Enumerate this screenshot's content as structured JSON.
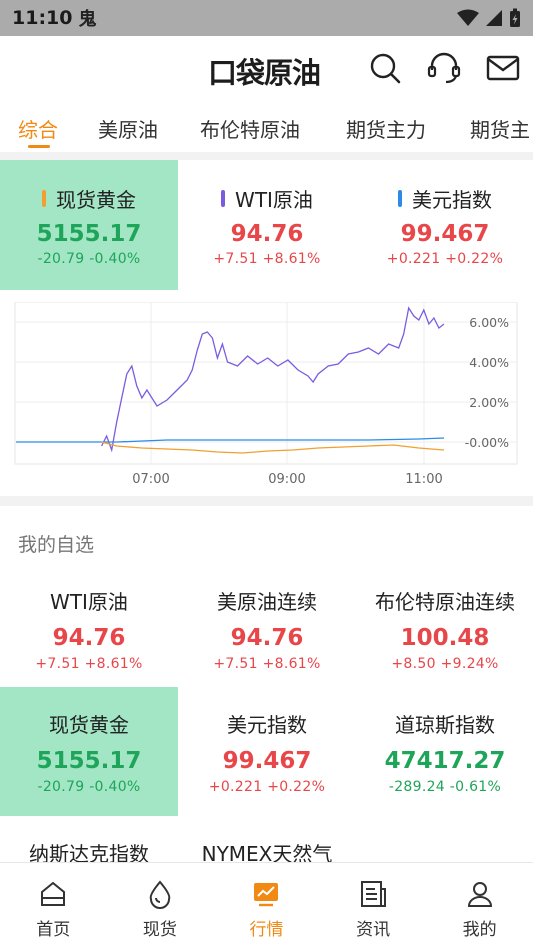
{
  "status": {
    "time": "11:10",
    "extra": "鬼"
  },
  "header": {
    "logo_text": "口袋原油"
  },
  "tabs": [
    {
      "label": "综合",
      "active": true
    },
    {
      "label": "美原油"
    },
    {
      "label": "布伦特原油"
    },
    {
      "label": "期货主力"
    },
    {
      "label": "期货主"
    }
  ],
  "top_indices": [
    {
      "name": "现货黄金",
      "price": "5155.17",
      "change": "-20.79",
      "percent": "-0.40%",
      "direction": "down",
      "marker_color": "#f0a030",
      "highlight": true
    },
    {
      "name": "WTI原油",
      "price": "94.76",
      "change": "+7.51",
      "percent": "+8.61%",
      "direction": "up",
      "marker_color": "#7b5ce0",
      "highlight": false
    },
    {
      "name": "美元指数",
      "price": "99.467",
      "change": "+0.221",
      "percent": "+0.22%",
      "direction": "up",
      "marker_color": "#2b8be6",
      "highlight": false
    }
  ],
  "chart_data": {
    "type": "line",
    "x_ticks": [
      "07:00",
      "09:00",
      "11:00"
    ],
    "y_ticks": [
      "6.00%",
      "4.00%",
      "2.00%",
      "-0.00%"
    ],
    "ylim": [
      -1.0,
      7.0
    ],
    "series": [
      {
        "name": "WTI原油",
        "color": "#7b5ce0",
        "points": [
          [
            0.17,
            -0.2
          ],
          [
            0.18,
            0.3
          ],
          [
            0.19,
            -0.4
          ],
          [
            0.2,
            1.0
          ],
          [
            0.21,
            2.2
          ],
          [
            0.22,
            3.4
          ],
          [
            0.23,
            3.8
          ],
          [
            0.24,
            2.8
          ],
          [
            0.25,
            2.2
          ],
          [
            0.26,
            2.6
          ],
          [
            0.28,
            1.8
          ],
          [
            0.3,
            2.1
          ],
          [
            0.32,
            2.6
          ],
          [
            0.34,
            3.1
          ],
          [
            0.35,
            3.6
          ],
          [
            0.36,
            4.6
          ],
          [
            0.37,
            5.4
          ],
          [
            0.38,
            5.5
          ],
          [
            0.39,
            5.2
          ],
          [
            0.4,
            4.2
          ],
          [
            0.41,
            4.9
          ],
          [
            0.42,
            4.0
          ],
          [
            0.44,
            3.8
          ],
          [
            0.46,
            4.3
          ],
          [
            0.48,
            3.9
          ],
          [
            0.5,
            4.2
          ],
          [
            0.52,
            3.8
          ],
          [
            0.54,
            4.1
          ],
          [
            0.56,
            3.6
          ],
          [
            0.58,
            3.3
          ],
          [
            0.59,
            3.0
          ],
          [
            0.6,
            3.4
          ],
          [
            0.62,
            3.8
          ],
          [
            0.64,
            3.9
          ],
          [
            0.66,
            4.4
          ],
          [
            0.68,
            4.5
          ],
          [
            0.7,
            4.7
          ],
          [
            0.72,
            4.4
          ],
          [
            0.74,
            4.9
          ],
          [
            0.76,
            4.7
          ],
          [
            0.77,
            5.4
          ],
          [
            0.78,
            6.7
          ],
          [
            0.79,
            6.3
          ],
          [
            0.8,
            6.1
          ],
          [
            0.81,
            6.6
          ],
          [
            0.82,
            5.9
          ],
          [
            0.83,
            6.2
          ],
          [
            0.84,
            5.7
          ],
          [
            0.85,
            5.9
          ]
        ]
      },
      {
        "name": "美元指数",
        "color": "#2b8be6",
        "points": [
          [
            0.0,
            0.0
          ],
          [
            0.17,
            0.0
          ],
          [
            0.2,
            0.0
          ],
          [
            0.3,
            0.1
          ],
          [
            0.4,
            0.1
          ],
          [
            0.5,
            0.1
          ],
          [
            0.6,
            0.1
          ],
          [
            0.7,
            0.1
          ],
          [
            0.8,
            0.15
          ],
          [
            0.85,
            0.2
          ]
        ]
      },
      {
        "name": "现货黄金",
        "color": "#f0a030",
        "points": [
          [
            0.17,
            0.0
          ],
          [
            0.2,
            -0.2
          ],
          [
            0.25,
            -0.3
          ],
          [
            0.3,
            -0.35
          ],
          [
            0.35,
            -0.4
          ],
          [
            0.4,
            -0.5
          ],
          [
            0.45,
            -0.55
          ],
          [
            0.5,
            -0.45
          ],
          [
            0.55,
            -0.4
          ],
          [
            0.6,
            -0.3
          ],
          [
            0.65,
            -0.25
          ],
          [
            0.7,
            -0.2
          ],
          [
            0.75,
            -0.15
          ],
          [
            0.8,
            -0.3
          ],
          [
            0.85,
            -0.4
          ]
        ]
      }
    ]
  },
  "watchlist": {
    "title": "我的自选",
    "items": [
      {
        "name": "WTI原油",
        "price": "94.76",
        "change": "+7.51",
        "percent": "+8.61%",
        "direction": "up",
        "highlight": false
      },
      {
        "name": "美原油连续",
        "price": "94.76",
        "change": "+7.51",
        "percent": "+8.61%",
        "direction": "up",
        "highlight": false
      },
      {
        "name": "布伦特原油连续",
        "price": "100.48",
        "change": "+8.50",
        "percent": "+9.24%",
        "direction": "up",
        "highlight": false
      },
      {
        "name": "现货黄金",
        "price": "5155.17",
        "change": "-20.79",
        "percent": "-0.40%",
        "direction": "down",
        "highlight": true
      },
      {
        "name": "美元指数",
        "price": "99.467",
        "change": "+0.221",
        "percent": "+0.22%",
        "direction": "up",
        "highlight": false
      },
      {
        "name": "道琼斯指数",
        "price": "47417.27",
        "change": "-289.24",
        "percent": "-0.61%",
        "direction": "down",
        "highlight": false
      },
      {
        "name": "纳斯达克指数",
        "price": "",
        "change": "",
        "percent": "",
        "direction": "",
        "highlight": false
      },
      {
        "name": "NYMEX天然气",
        "price": "",
        "change": "",
        "percent": "",
        "direction": "",
        "highlight": false
      }
    ]
  },
  "nav": [
    {
      "label": "首页",
      "icon": "home-icon"
    },
    {
      "label": "现货",
      "icon": "drop-icon"
    },
    {
      "label": "行情",
      "icon": "chart-icon",
      "active": true
    },
    {
      "label": "资讯",
      "icon": "news-icon"
    },
    {
      "label": "我的",
      "icon": "user-icon"
    }
  ]
}
